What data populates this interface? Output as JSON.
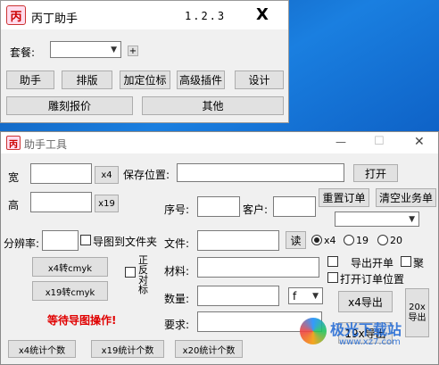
{
  "top_window": {
    "title": "丙丁助手",
    "version": "1.2.3",
    "close_glyph": "X",
    "package_label": "套餐:",
    "plus_glyph": "+",
    "buttons_row1": [
      "助手",
      "排版",
      "加定位标",
      "高级插件",
      "设计"
    ],
    "buttons_row2": [
      "雕刻报价",
      "其他"
    ]
  },
  "tool_window": {
    "title": "助手工具",
    "win_min": "—",
    "win_max": "☐",
    "win_close": "✕",
    "width_label": "宽",
    "height_label": "高",
    "x4_btn": "x4",
    "x19_btn": "x19",
    "save_label": "保存位置:",
    "open_btn": "打开",
    "reset_order_btn": "重置订单",
    "clear_btn": "清空业务单",
    "seq_label": "序号:",
    "customer_label": "客户:",
    "resolution_label": "分辨率:",
    "export_to_folder": "导图到文件夹",
    "file_label": "文件:",
    "read_btn": "读",
    "radio_options": [
      "x4",
      "19",
      "20"
    ],
    "x4_cmyk_btn": "x4转cmyk",
    "x19_cmyk_btn": "x19转cmyk",
    "mirror_label": "正反对标",
    "material_label": "材料:",
    "export_order_label": "导出开单",
    "merge_label": "聚",
    "open_order_pos_label": "打开订单位置",
    "qty_label": "数量:",
    "qty_unit_value": "f",
    "x4_export_btn": "x4导出",
    "x20_export_btn": "20x导出",
    "x19_export_btn": "19x导出",
    "status_text": "等待导图操作!",
    "require_label": "要求:",
    "x4_count_btn": "x4统计个数",
    "x19_count_btn": "x19统计个数",
    "x20_count_btn": "x20统计个数"
  },
  "watermark": {
    "brand": "极光下载站",
    "url": "www.xz7.com"
  },
  "colors": {
    "status_red": "#e00000",
    "desktop_blue": "#1a7fe0",
    "titlebar_gray": "#f0f0f0"
  }
}
